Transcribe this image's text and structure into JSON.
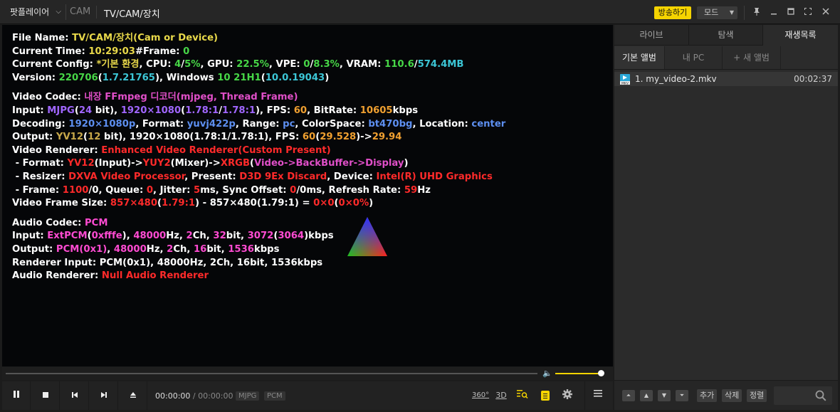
{
  "titlebar": {
    "app_menu": "팟플레이어",
    "crumb_source": "CAM",
    "title": "TV/CAM/장치",
    "broadcast_label": "방송하기",
    "mode_label": "모드"
  },
  "osd": {
    "file_name_label": "File Name: ",
    "file_name": "TV/CAM/장치(Cam or Device)",
    "current_time_label": "Current Time: ",
    "current_time": "10:29:03",
    "frame_label": "#Frame: ",
    "frame": "0",
    "config_label": "Current Config: ",
    "config_name": "*기본 환경",
    "cpu_label": ", CPU: ",
    "cpu_a": "4",
    "cpu_b": "5%",
    "gpu_label": ", GPU: ",
    "gpu": "22.5%",
    "vpe_label": ", VPE: ",
    "vpe_a": "0",
    "vpe_b": "8.3%",
    "vram_label": ", VRAM: ",
    "vram_a": "110.6",
    "vram_b": "574.4MB",
    "version_label": "Version: ",
    "version": "220706",
    "version_build": "1.7.21765",
    "windows_label": ", Windows ",
    "windows": "10 21H1",
    "windows_build": "10.0.19043",
    "video_codec_label": "Video Codec: ",
    "video_codec": "내장 FFmpeg 디코더(mjpeg, Thread Frame)",
    "input_label": "Input: ",
    "input_fmt": "MJPG",
    "input_bits": "24",
    "input_res": "1920×1080",
    "input_ar1": "1.78:1",
    "input_ar2": "1.78:1",
    "input_fps": "60",
    "input_bitrate": "10605",
    "dec_label": "Decoding: ",
    "dec_res": "1920×1080p",
    "dec_format": "yuvj422p",
    "dec_range": "pc",
    "dec_colorspace": "bt470bg",
    "dec_location": "center",
    "out_label": "Output: ",
    "out_fmt": "YV12",
    "out_bits": "12",
    "out_res": "1920×1080(1.78:1/1.78:1)",
    "out_fps": "60",
    "out_fps_actual": "29.528",
    "out_fps_target": "29.94",
    "renderer_label": "Video Renderer: ",
    "renderer": "Enhanced Video Renderer(Custom Present)",
    "fmt_in": "YV12",
    "fmt_mix": "YUY2",
    "fmt_out": "XRGB",
    "fmt_flow": "Video->BackBuffer->Display",
    "resizer": "DXVA Video Processor",
    "present": "D3D 9Ex Discard",
    "device": "Intel(R) UHD Graphics",
    "frame_a": "1100",
    "frame_b": "0",
    "queue": "0",
    "jitter": "5",
    "sync_a": "0",
    "sync_b": "0",
    "refresh": "59",
    "vfs_label": "Video Frame Size: ",
    "vfs_a": "857×480",
    "vfs_b": "1.79:1",
    "vfs_c": "857×480(1.79:1)",
    "vfs_d": "0×0",
    "vfs_e": "0×0%",
    "audio_codec_label": "Audio Codec: ",
    "audio_codec": "PCM",
    "a_input_fmt": "ExtPCM",
    "a_input_mask": "0xfffe",
    "a_input_hz": "48000",
    "a_input_ch": "2",
    "a_input_bit": "32",
    "a_input_kbps1": "3072",
    "a_input_kbps2": "3064",
    "a_out_fmt": "PCM(0x1)",
    "a_out_hz": "48000",
    "a_out_ch": "2",
    "a_out_bit": "16",
    "a_out_kbps": "1536",
    "renderer_input_label": "Renderer Input: ",
    "renderer_input": "PCM(0x1), 48000Hz, 2Ch, 16bit, 1536kbps",
    "audio_renderer_label": "Audio Renderer: ",
    "audio_renderer": "Null Audio Renderer"
  },
  "player": {
    "seek_progress": 0,
    "volume_level": 0.95,
    "current_time": "00:00:00",
    "duration": "00:00:00",
    "video_tag": "MJPG",
    "audio_tag": "PCM",
    "btn_360": "360°",
    "btn_3d": "3D"
  },
  "panel": {
    "tabs": [
      "라이브",
      "탐색",
      "재생목록"
    ],
    "active_tab": "재생목록",
    "subtabs": [
      "기본 앨범",
      "내 PC",
      "+ 새 앨범"
    ],
    "playlist": [
      {
        "name": "1. my_video-2.mkv",
        "duration": "00:02:37"
      }
    ],
    "footer": {
      "add": "추가",
      "delete": "삭제",
      "sort": "정렬"
    }
  },
  "colors": {
    "accent": "#f5d400"
  }
}
